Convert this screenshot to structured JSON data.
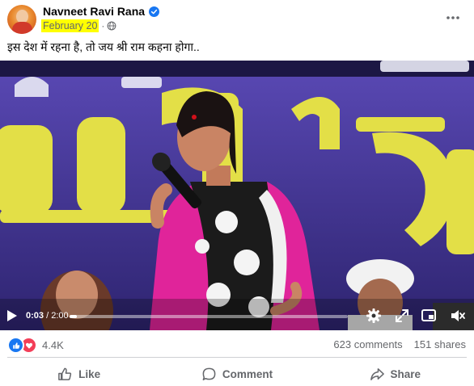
{
  "post": {
    "author": "Navneet Ravi Rana",
    "date": "February 20",
    "separator": "·",
    "caption": "इस देश में रहना है, तो जय श्री राम कहना होगा.."
  },
  "video": {
    "current_time": "0:03",
    "time_separator": " / ",
    "duration": "2:00",
    "progress_fraction": 0.025
  },
  "stats": {
    "reactions_count": "4.4K",
    "comments": "623 comments",
    "shares": "151 shares"
  },
  "actions": {
    "like": "Like",
    "comment": "Comment",
    "share": "Share"
  },
  "icons": [
    "verified-icon",
    "globe-icon",
    "more-options-icon",
    "play-icon",
    "settings-icon",
    "fullscreen-icon",
    "pip-icon",
    "volume-icon",
    "like-reaction-icon",
    "love-reaction-icon",
    "thumbs-up-icon",
    "comment-icon",
    "share-icon"
  ],
  "colors": {
    "accent": "#1877f2",
    "love": "#f33e58",
    "highlight": "#ffff00",
    "muted_text": "#65676b",
    "banner_purple": "#4a38a8",
    "banner_yellow": "#e8e04a",
    "saree_pink": "#e0249a"
  }
}
